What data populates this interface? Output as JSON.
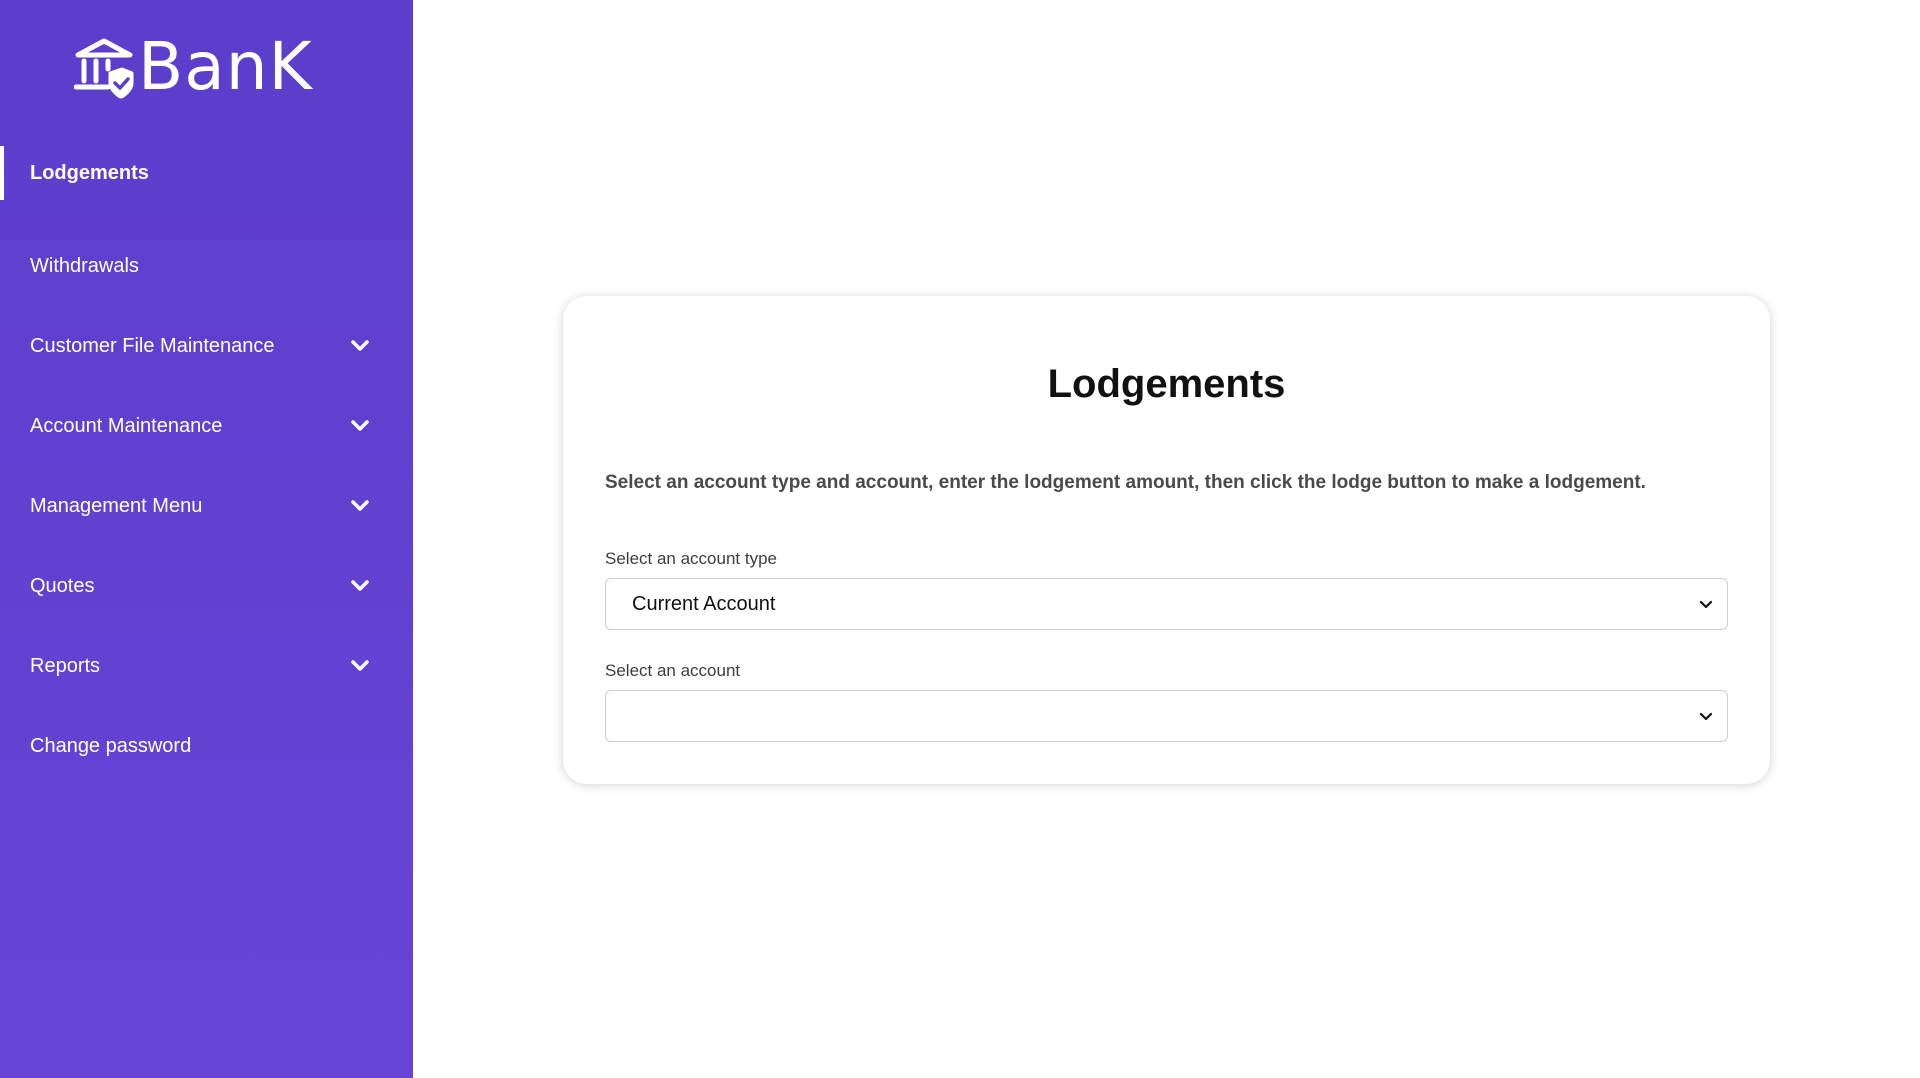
{
  "brand": {
    "name": "BanK",
    "icon": "bank-shield-icon"
  },
  "sidebar": {
    "items": [
      {
        "label": "Lodgements",
        "active": true,
        "expandable": false
      },
      {
        "label": "Withdrawals",
        "active": false,
        "expandable": false
      },
      {
        "label": "Customer File Maintenance",
        "active": false,
        "expandable": true
      },
      {
        "label": "Account Maintenance",
        "active": false,
        "expandable": true
      },
      {
        "label": "Management Menu",
        "active": false,
        "expandable": true
      },
      {
        "label": "Quotes",
        "active": false,
        "expandable": true
      },
      {
        "label": "Reports",
        "active": false,
        "expandable": true
      },
      {
        "label": "Change password",
        "active": false,
        "expandable": false
      }
    ]
  },
  "main": {
    "title": "Lodgements",
    "description": "Select an account type and account, enter the lodgement amount, then click the lodge button to make a lodgement.",
    "account_type": {
      "label": "Select an account type",
      "value": "Current Account"
    },
    "account": {
      "label": "Select an account",
      "value": ""
    }
  },
  "colors": {
    "sidebar_top": "#5b3ecb",
    "sidebar_bottom": "#6744d6",
    "text_on_sidebar": "#ffffff"
  }
}
